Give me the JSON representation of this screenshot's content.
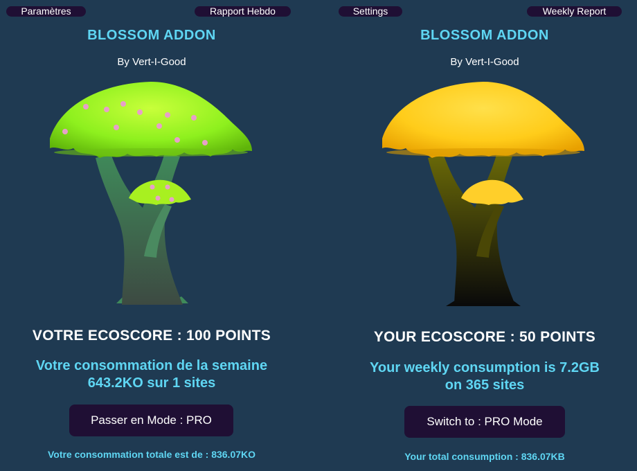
{
  "left": {
    "settings_label": "Paramètres",
    "report_label": "Rapport Hebdo",
    "title": "BLOSSOM ADDON",
    "byline": "By Vert-I-Good",
    "score": "VOTRE ECOSCORE : 100 POINTS",
    "weekly_line1": "Votre consommation de la semaine",
    "weekly_line2": "643.2KO sur 1 sites",
    "pro_button": "Passer en Mode : PRO",
    "total": "Votre consommation totale est de : 836.07KO",
    "mushroom_state": "healthy-blossoming",
    "colors": {
      "cap": "#8ef01e",
      "stem_top": "#3f8a5a",
      "stem_bottom": "#3a4d40",
      "flower": "#e8a0c8"
    }
  },
  "right": {
    "settings_label": "Settings",
    "report_label": "Weekly Report",
    "title": "BLOSSOM ADDON",
    "byline": "By Vert-I-Good",
    "score": "YOUR ECOSCORE : 50 POINTS",
    "weekly_line1": "Your weekly consumption is 7.2GB",
    "weekly_line2": "on 365 sites",
    "pro_button": "Switch to : PRO Mode",
    "total": "Your total consumption : 836.07KB",
    "mushroom_state": "wilting-yellow",
    "colors": {
      "cap": "#ffd21a",
      "stem_top": "#6b6a08",
      "stem_bottom": "#0a0a0a"
    }
  },
  "theme": {
    "background": "#1f3a52",
    "button_bg": "#1f0f34",
    "accent": "#5fd6f3"
  }
}
